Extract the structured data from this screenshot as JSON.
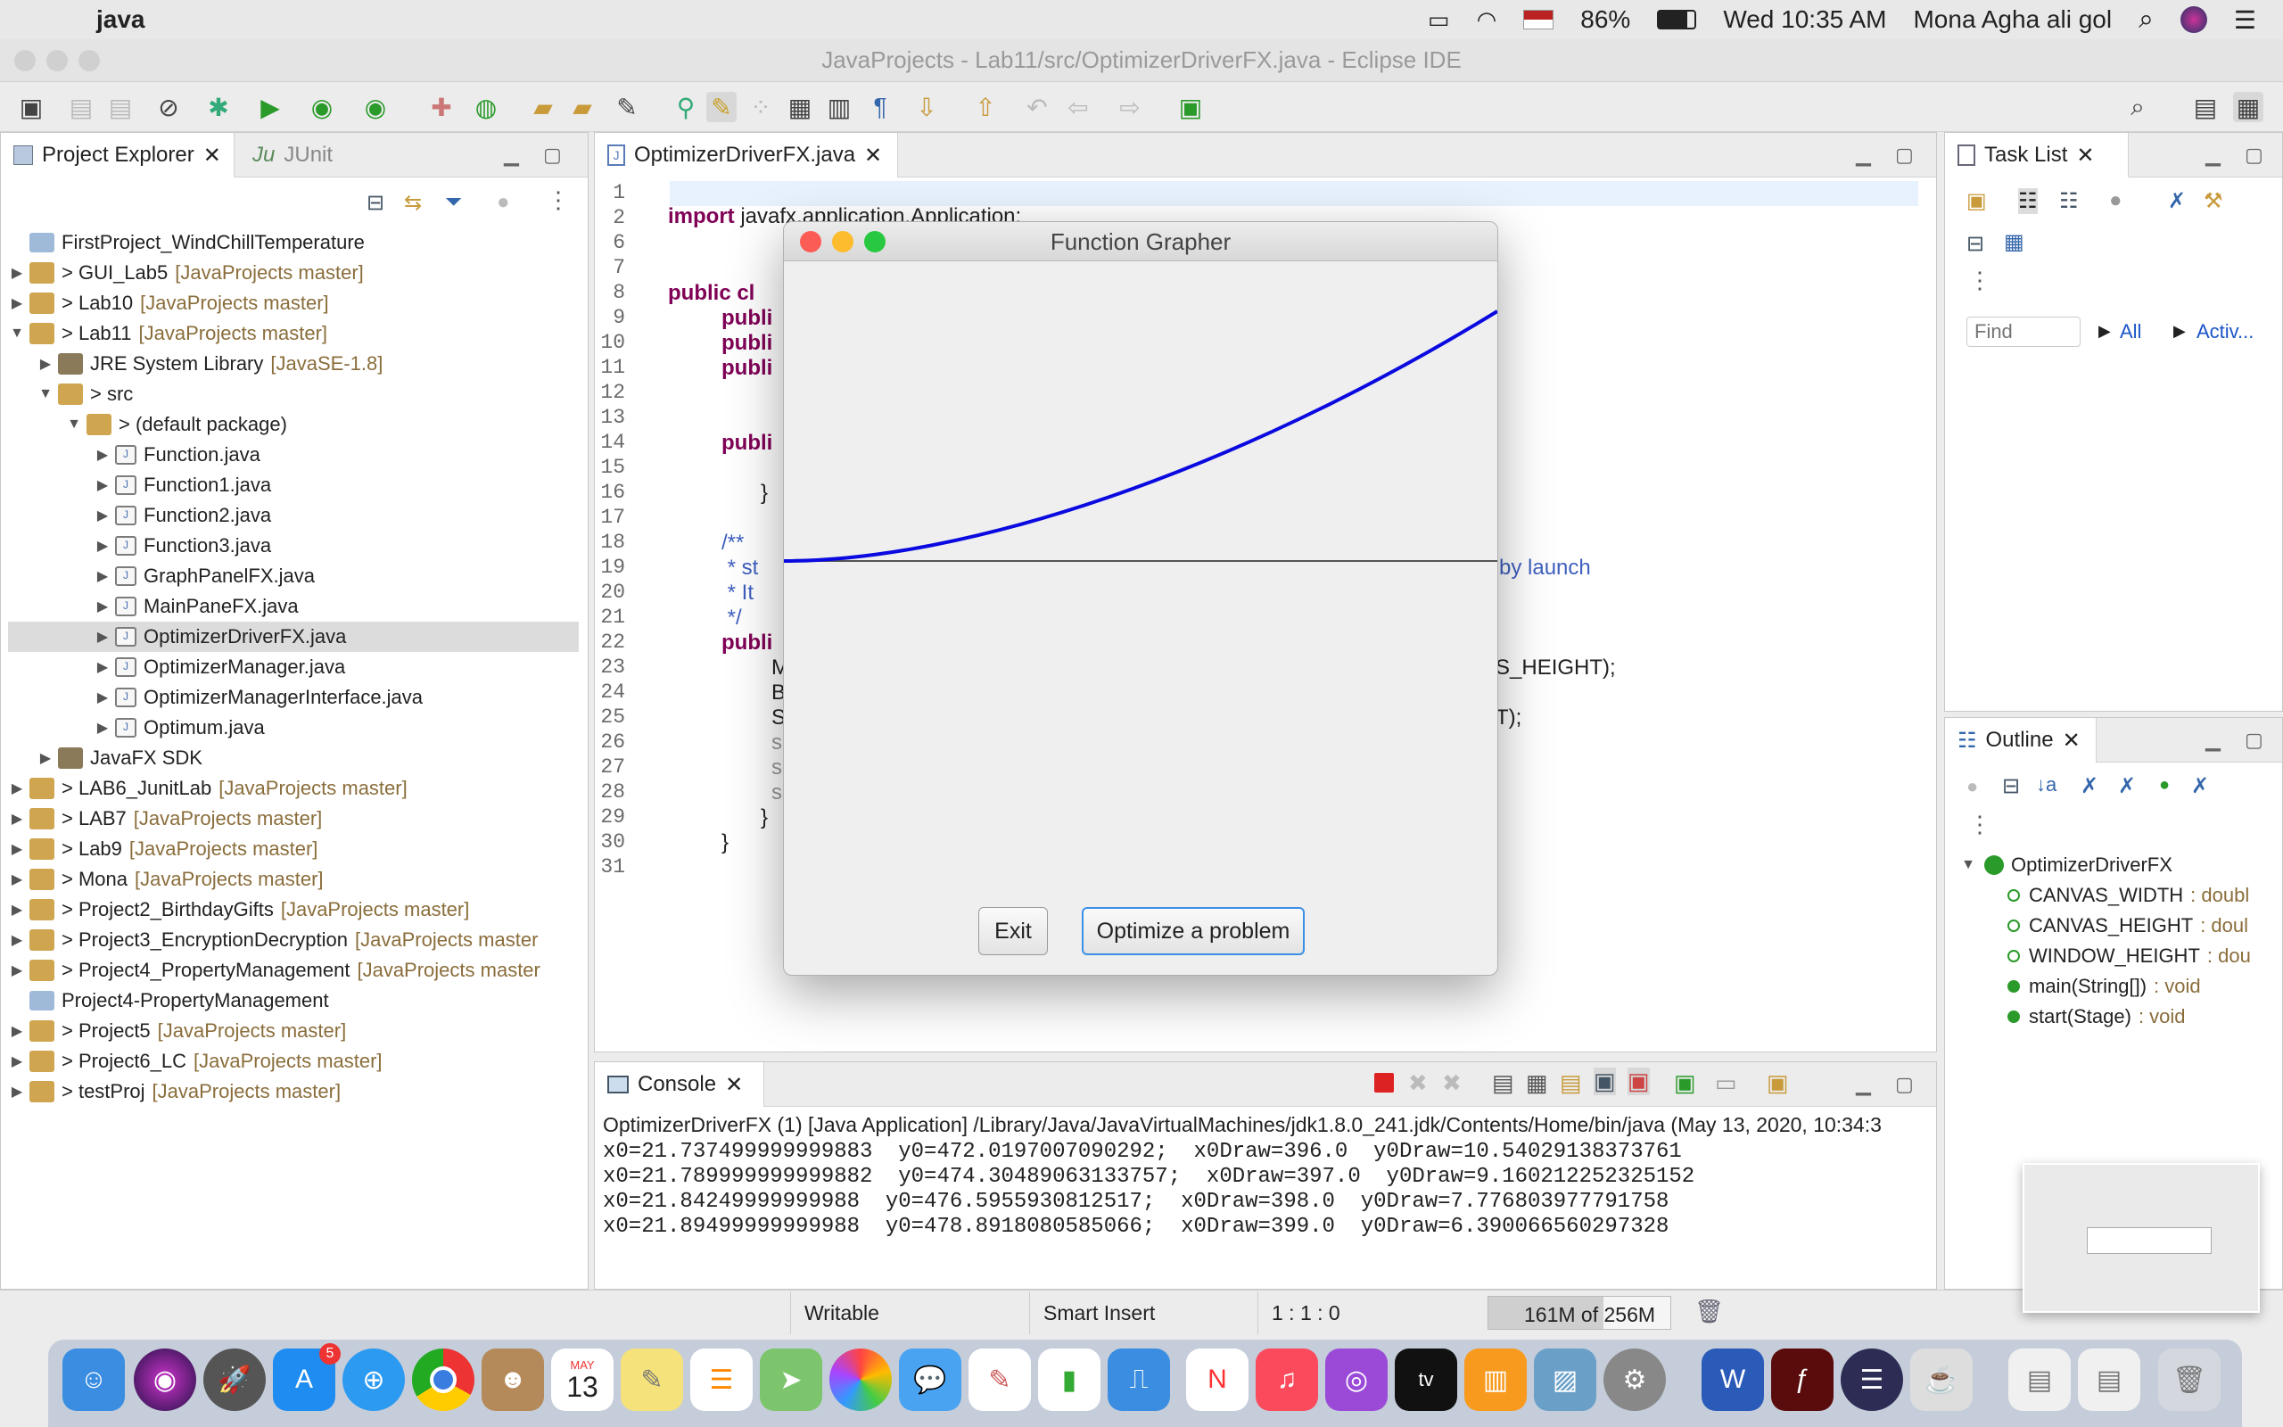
{
  "menubar": {
    "app_name": "java",
    "battery": "86%",
    "datetime": "Wed 10:35 AM",
    "user": "Mona Agha ali gol"
  },
  "window": {
    "title": "JavaProjects - Lab11/src/OptimizerDriverFX.java - Eclipse IDE"
  },
  "explorer": {
    "tab_label": "Project Explorer",
    "junit_label": "JUnit",
    "items": [
      {
        "label": "FirstProject_WindChillTemperature",
        "repo": ""
      },
      {
        "label": "> GUI_Lab5",
        "repo": "[JavaProjects master]"
      },
      {
        "label": "> Lab10",
        "repo": "[JavaProjects master]"
      },
      {
        "label": "> Lab11",
        "repo": "[JavaProjects master]"
      },
      {
        "label": "JRE System Library",
        "repo": "[JavaSE-1.8]"
      },
      {
        "label": "> src",
        "repo": ""
      },
      {
        "label": "> (default package)",
        "repo": ""
      },
      {
        "label": "Function.java",
        "repo": ""
      },
      {
        "label": "Function1.java",
        "repo": ""
      },
      {
        "label": "Function2.java",
        "repo": ""
      },
      {
        "label": "Function3.java",
        "repo": ""
      },
      {
        "label": "GraphPanelFX.java",
        "repo": ""
      },
      {
        "label": "MainPaneFX.java",
        "repo": ""
      },
      {
        "label": "OptimizerDriverFX.java",
        "repo": ""
      },
      {
        "label": "OptimizerManager.java",
        "repo": ""
      },
      {
        "label": "OptimizerManagerInterface.java",
        "repo": ""
      },
      {
        "label": "Optimum.java",
        "repo": ""
      },
      {
        "label": "JavaFX SDK",
        "repo": ""
      },
      {
        "label": "> LAB6_JunitLab",
        "repo": "[JavaProjects master]"
      },
      {
        "label": "> LAB7",
        "repo": "[JavaProjects master]"
      },
      {
        "label": "> Lab9",
        "repo": "[JavaProjects master]"
      },
      {
        "label": "> Mona",
        "repo": "[JavaProjects master]"
      },
      {
        "label": "> Project2_BirthdayGifts",
        "repo": "[JavaProjects master]"
      },
      {
        "label": "> Project3_EncryptionDecryption",
        "repo": "[JavaProjects master"
      },
      {
        "label": "> Project4_PropertyManagement",
        "repo": "[JavaProjects master"
      },
      {
        "label": "Project4-PropertyManagement",
        "repo": ""
      },
      {
        "label": "> Project5",
        "repo": "[JavaProjects master]"
      },
      {
        "label": "> Project6_LC",
        "repo": "[JavaProjects master]"
      },
      {
        "label": "> testProj",
        "repo": "[JavaProjects master]"
      }
    ]
  },
  "editor": {
    "tab_label": "OptimizerDriverFX.java",
    "line_numbers": [
      "1",
      "2",
      "6",
      "7",
      "8",
      "9",
      "10",
      "11",
      "12",
      "13",
      "14",
      "15",
      "16",
      "17",
      "18",
      "19",
      "20",
      "21",
      "22",
      "23",
      "24",
      "25",
      "26",
      "27",
      "28",
      "29",
      "30",
      "31"
    ],
    "code": {
      "l2_kw": "import",
      "l2_rest": " javafx.application.Application;",
      "l8_kw": "public cl",
      "l9_kw": "publi",
      "l10_kw": "publi",
      "l11_kw": "publi",
      "l14_kw": "publi",
      "l16": "}",
      "l18": "/**",
      "l19": " * st",
      "l19_tail": "by launch",
      "l20": " * It",
      "l21": " */",
      "l22_kw": "publi",
      "l23": "M",
      "l23_tail": "S_HEIGHT);",
      "l24": "B",
      "l25": "S",
      "l25_tail": "T);",
      "l26": "s",
      "l27": "s",
      "l28": "s",
      "l29": "}",
      "l30": "}"
    }
  },
  "dialog": {
    "title": "Function Grapher",
    "exit_label": "Exit",
    "optimize_label": "Optimize a problem"
  },
  "tasklist": {
    "tab_label": "Task List",
    "find_placeholder": "Find",
    "all_label": "All",
    "activate_label": "Activ..."
  },
  "outline": {
    "tab_label": "Outline",
    "class_name": "OptimizerDriverFX",
    "members": [
      {
        "name": "CANVAS_WIDTH",
        "type": ": doubl"
      },
      {
        "name": "CANVAS_HEIGHT",
        "type": ": doul"
      },
      {
        "name": "WINDOW_HEIGHT",
        "type": ": dou"
      },
      {
        "name": "main(String[])",
        "type": ": void"
      },
      {
        "name": "start(Stage)",
        "type": ": void"
      }
    ]
  },
  "console": {
    "tab_label": "Console",
    "header": "OptimizerDriverFX (1) [Java Application] /Library/Java/JavaVirtualMachines/jdk1.8.0_241.jdk/Contents/Home/bin/java (May 13, 2020, 10:34:3",
    "lines": [
      "x0=21.737499999999883  y0=472.0197007090292;  x0Draw=396.0  y0Draw=10.54029138373761",
      "x0=21.789999999999882  y0=474.30489063133757;  x0Draw=397.0  y0Draw=9.160212252325152",
      "x0=21.84249999999988  y0=476.5955930812517;  x0Draw=398.0  y0Draw=7.776803977791758",
      "x0=21.89499999999988  y0=478.8918080585066;  x0Draw=399.0  y0Draw=6.390066560297328"
    ]
  },
  "statusbar": {
    "writable": "Writable",
    "insert_mode": "Smart Insert",
    "position": "1 : 1 : 0",
    "heap": "161M of 256M"
  },
  "dock": {
    "calendar_month": "MAY",
    "calendar_day": "13",
    "appstore_badge": "5"
  }
}
